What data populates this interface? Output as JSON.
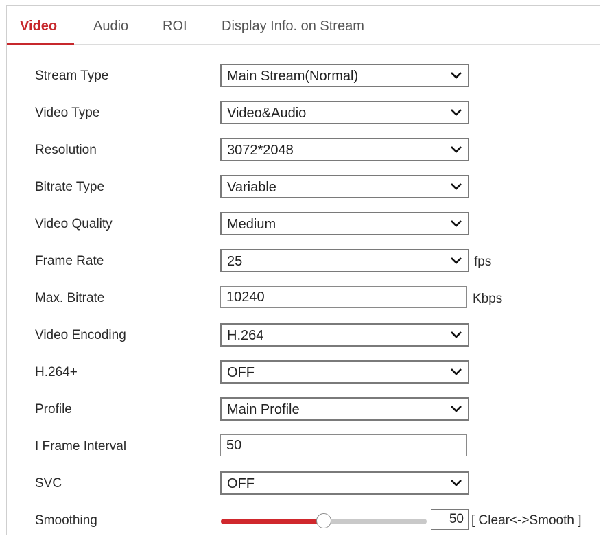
{
  "tabs": [
    {
      "label": "Video",
      "active": true
    },
    {
      "label": "Audio",
      "active": false
    },
    {
      "label": "ROI",
      "active": false
    },
    {
      "label": "Display Info. on Stream",
      "active": false
    }
  ],
  "fields": {
    "stream_type": {
      "label": "Stream Type",
      "value": "Main Stream(Normal)"
    },
    "video_type": {
      "label": "Video Type",
      "value": "Video&Audio"
    },
    "resolution": {
      "label": "Resolution",
      "value": "3072*2048"
    },
    "bitrate_type": {
      "label": "Bitrate Type",
      "value": "Variable"
    },
    "video_quality": {
      "label": "Video Quality",
      "value": "Medium"
    },
    "frame_rate": {
      "label": "Frame Rate",
      "value": "25",
      "unit": "fps"
    },
    "max_bitrate": {
      "label": "Max. Bitrate",
      "value": "10240",
      "unit": "Kbps"
    },
    "video_encoding": {
      "label": "Video Encoding",
      "value": "H.264"
    },
    "h264_plus": {
      "label": "H.264+",
      "value": "OFF"
    },
    "profile": {
      "label": "Profile",
      "value": "Main Profile"
    },
    "i_frame_interval": {
      "label": "I Frame Interval",
      "value": "50"
    },
    "svc": {
      "label": "SVC",
      "value": "OFF"
    },
    "smoothing": {
      "label": "Smoothing",
      "value": "50",
      "fraction": 0.5,
      "hint": "[ Clear<->Smooth ]"
    }
  },
  "colors": {
    "accent": "#c7282c",
    "slider_fill": "#d0282d",
    "track": "#c9c9c9"
  },
  "icons": {
    "dropdown": "chevron-down-icon",
    "slider": "slider-thumb"
  }
}
